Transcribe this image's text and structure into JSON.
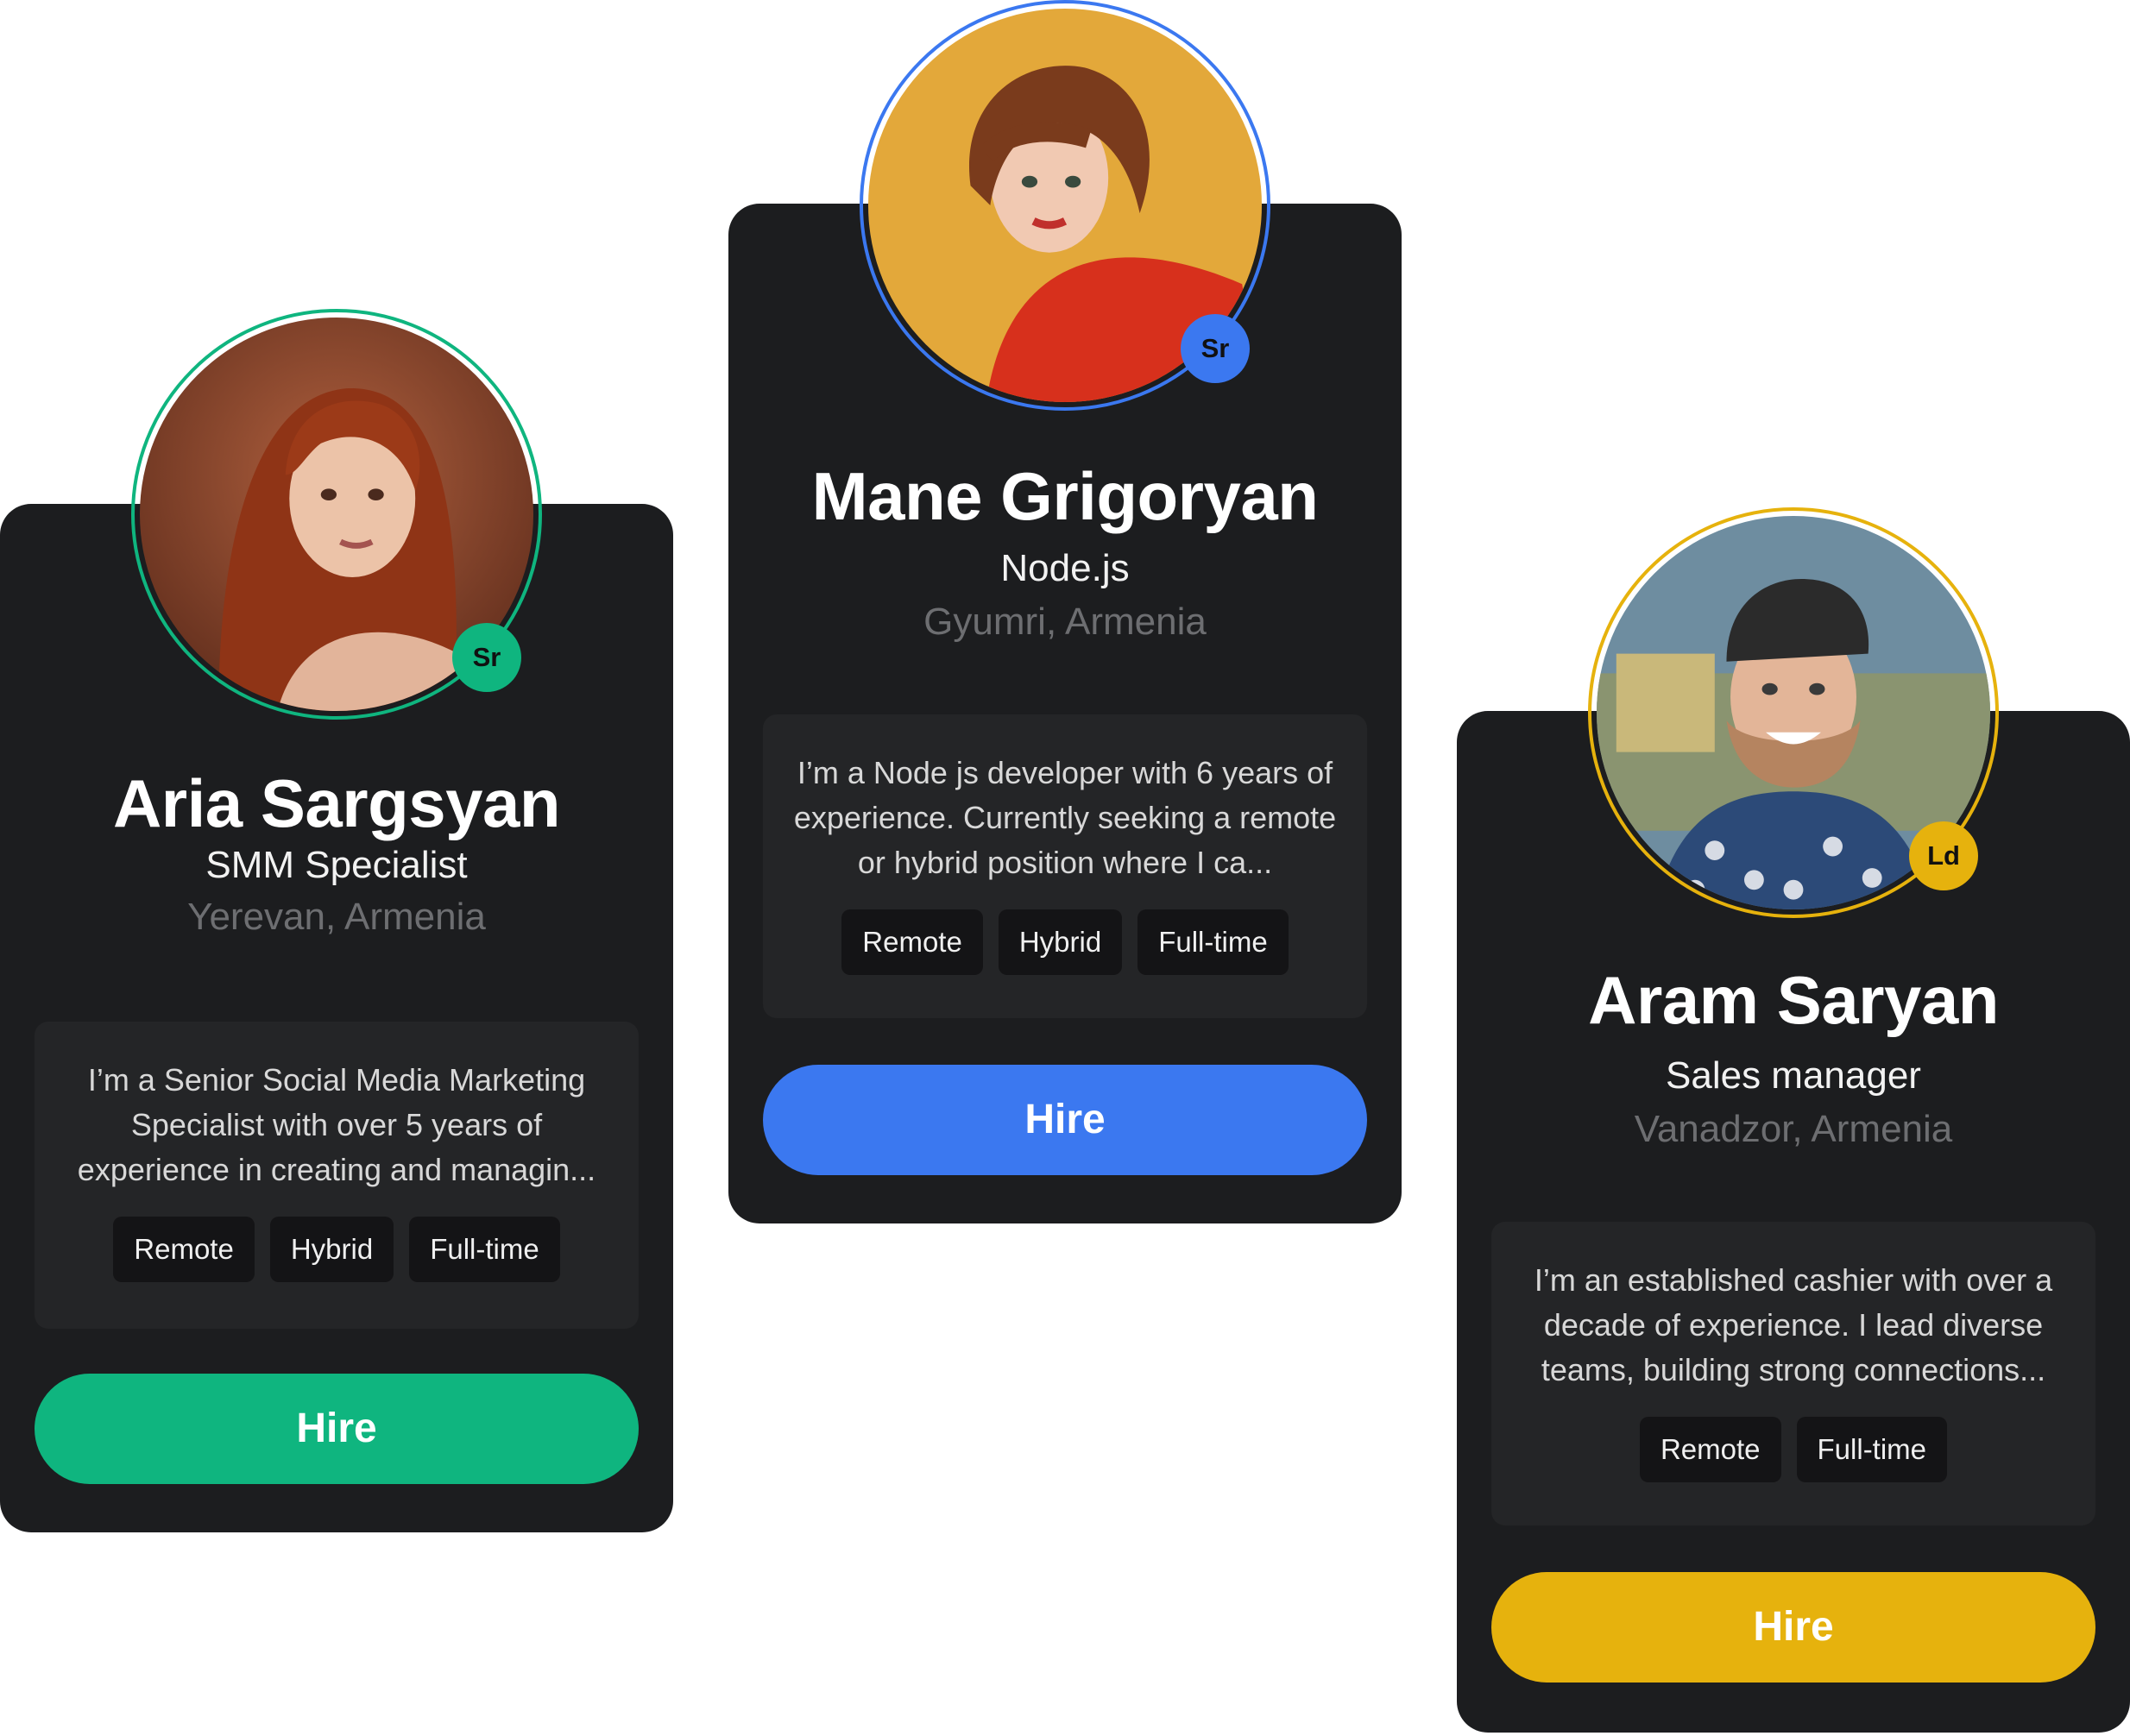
{
  "cards": [
    {
      "name": "Aria Sargsyan",
      "role": "SMM Specialist",
      "location": "Yerevan, Armenia",
      "level": "Sr",
      "accent": "#0fb57f",
      "bio": "I’m a Senior Social Media Marketing Specialist with over 5 years of experience in creating and managin...",
      "tags": [
        "Remote",
        "Hybrid",
        "Full-time"
      ],
      "hire_label": "Hire"
    },
    {
      "name": "Mane Grigoryan",
      "role": "Node.js",
      "location": "Gyumri, Armenia",
      "level": "Sr",
      "accent": "#3b78f0",
      "bio": "I’m a Node js developer with 6 years of experience. Currently seeking a remote or hybrid position where I ca...",
      "tags": [
        "Remote",
        "Hybrid",
        "Full-time"
      ],
      "hire_label": "Hire"
    },
    {
      "name": "Aram Saryan",
      "role": "Sales manager",
      "location": "Vanadzor, Armenia",
      "level": "Ld",
      "accent": "#e6b20d",
      "bio": "I’m an established cashier with over a decade of experience. I lead diverse teams, building strong connections...",
      "tags": [
        "Remote",
        "Full-time"
      ],
      "hire_label": "Hire"
    }
  ]
}
